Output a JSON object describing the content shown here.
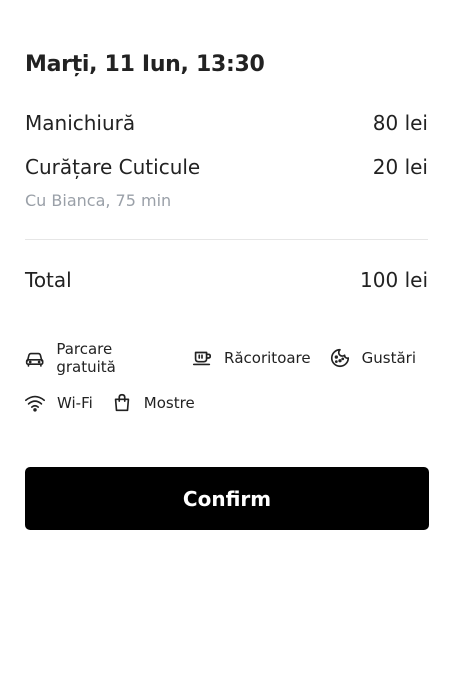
{
  "booking": {
    "date_time": "Marți, 11 Iun, 13:30",
    "services": [
      {
        "name": "Manichiură",
        "price": "80 lei"
      },
      {
        "name": "Curățare Cuticule",
        "price": "20 lei"
      }
    ],
    "meta": "Cu Bianca, 75 min",
    "total_label": "Total",
    "total_value": "100 lei"
  },
  "amenities": [
    {
      "icon": "car-icon",
      "label": "Parcare gratuită"
    },
    {
      "icon": "drink-icon",
      "label": "Răcoritoare"
    },
    {
      "icon": "cookie-icon",
      "label": "Gustări"
    },
    {
      "icon": "wifi-icon",
      "label": "Wi-Fi"
    },
    {
      "icon": "bag-icon",
      "label": "Mostre"
    }
  ],
  "confirm_label": "Confirm"
}
